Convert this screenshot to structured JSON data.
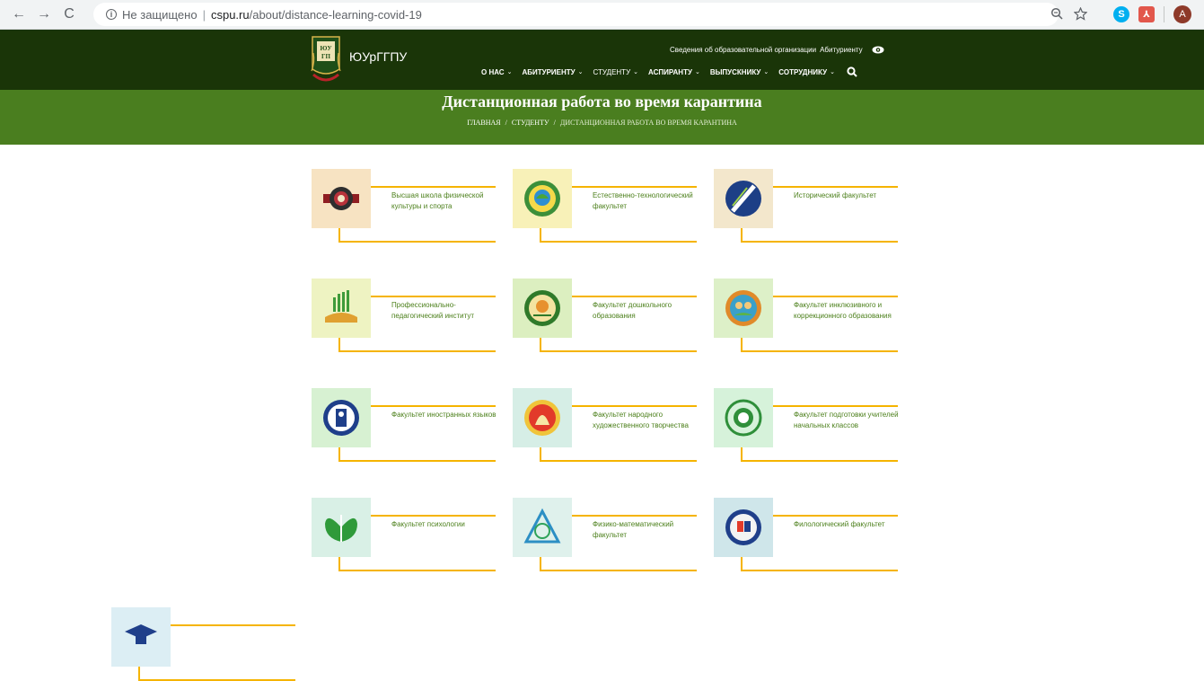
{
  "browser": {
    "back": "←",
    "forward": "→",
    "reload": "C",
    "security_label": "Не защищено",
    "host": "cspu.ru",
    "path": "/about/distance-learning-covid-19",
    "avatar_letter": "A"
  },
  "site": {
    "logo_text": "ЮУрГГПУ",
    "top_links": [
      "Сведения об образовательной организации",
      "Абитуриенту"
    ],
    "nav": [
      {
        "label": "О НАС",
        "has_dropdown": true
      },
      {
        "label": "АБИТУРИЕНТУ",
        "has_dropdown": true
      },
      {
        "label": "СТУДЕНТУ",
        "has_dropdown": true
      },
      {
        "label": "АСПИРАНТУ",
        "has_dropdown": true
      },
      {
        "label": "ВЫПУСКНИКУ",
        "has_dropdown": true
      },
      {
        "label": "СОТРУДНИКУ",
        "has_dropdown": true
      }
    ]
  },
  "page": {
    "title": "Дистанционная работа во время карантина",
    "breadcrumb": [
      "ГЛАВНАЯ",
      "СТУДЕНТУ",
      "ДИСТАНЦИОННАЯ РАБОТА ВО ВРЕМЯ КАРАНТИНА"
    ]
  },
  "faculties": [
    {
      "label": "Высшая школа физической культуры и спорта",
      "icon": "sports-emblem-icon",
      "bg": "#f7e3c2"
    },
    {
      "label": "Естественно-технологический факультет",
      "icon": "nature-emblem-icon",
      "bg": "#f8f1b8"
    },
    {
      "label": "Исторический факультет",
      "icon": "history-emblem-icon",
      "bg": "#f3e7cc"
    },
    {
      "label": "Профессионально-педагогический институт",
      "icon": "professional-emblem-icon",
      "bg": "#eef3c2"
    },
    {
      "label": "Факультет дошкольного образования",
      "icon": "preschool-emblem-icon",
      "bg": "#dcefc0"
    },
    {
      "label": "Факультет инклюзивного и коррекционного образования",
      "icon": "inclusive-emblem-icon",
      "bg": "#ddf0c8"
    },
    {
      "label": "Факультет иностранных языков",
      "icon": "languages-emblem-icon",
      "bg": "#d7f1d2"
    },
    {
      "label": "Факультет народного художественного творчества",
      "icon": "folk-art-emblem-icon",
      "bg": "#d6eee6"
    },
    {
      "label": "Факультет подготовки учителей начальных классов",
      "icon": "primary-teachers-emblem-icon",
      "bg": "#d6f2da"
    },
    {
      "label": "Факультет психологии",
      "icon": "psychology-emblem-icon",
      "bg": "#d9f0e6"
    },
    {
      "label": "Физико-математический факультет",
      "icon": "physics-math-emblem-icon",
      "bg": "#dff1ec"
    },
    {
      "label": "Филологический факультет",
      "icon": "philology-emblem-icon",
      "bg": "#cfe6ea"
    },
    {
      "label": "",
      "icon": "graduate-emblem-icon",
      "bg": "#dceef4"
    }
  ],
  "colors": {
    "header_bg": "#1a3508",
    "title_band": "#4a7e1f",
    "accent_line": "#f5b400",
    "link_text": "#4b7f1a"
  }
}
